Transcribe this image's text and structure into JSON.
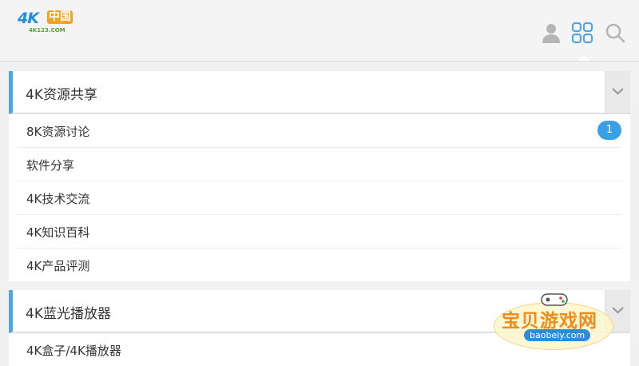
{
  "header": {
    "logo_main": "4K",
    "logo_cn": "中国",
    "logo_sub": "4K123.COM",
    "icons": [
      "user-icon",
      "grid-icon",
      "search-icon"
    ]
  },
  "sections": [
    {
      "title": "4K资源共享",
      "items": [
        {
          "label": "8K资源讨论",
          "badge": "1"
        },
        {
          "label": "软件分享"
        },
        {
          "label": "4K技术交流"
        },
        {
          "label": "4K知识百科"
        },
        {
          "label": "4K产品评测"
        }
      ]
    },
    {
      "title": "4K蓝光播放器",
      "items": [
        {
          "label": "4K盒子/4K播放器"
        }
      ]
    }
  ],
  "watermark": {
    "text": "宝贝游戏网",
    "url": "baobeiy.com"
  },
  "colors": {
    "accent": "#4fa6e0",
    "badge": "#3aa0e6",
    "icon_active": "#4fa6e0",
    "icon_inactive": "#b5b5b5"
  }
}
